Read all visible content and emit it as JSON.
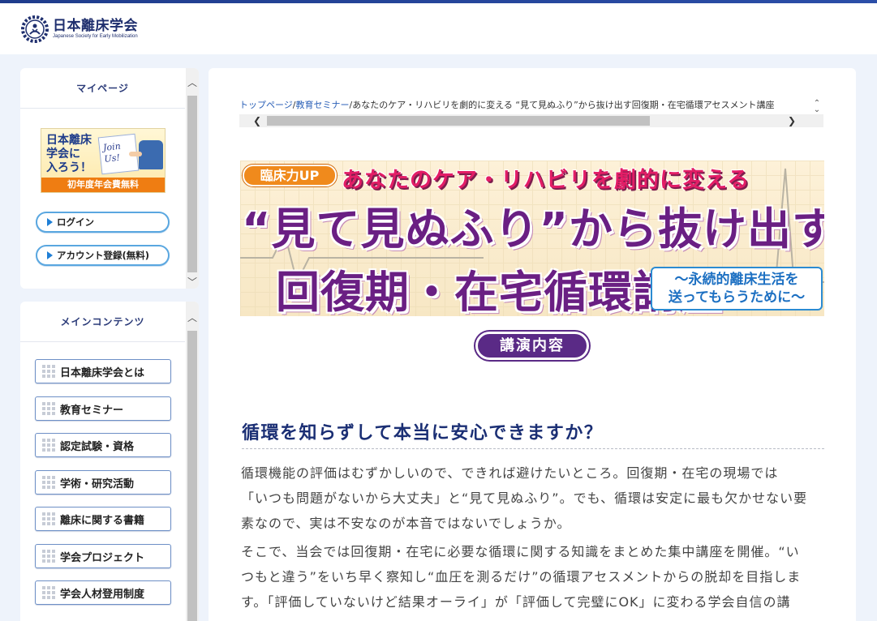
{
  "header": {
    "logo_ja": "日本離床学会",
    "logo_en": "Japanese Society for Early Mobilization"
  },
  "sidebar": {
    "mypage_title": "マイページ",
    "join_banner": {
      "line1": "日本離床",
      "line2": "学会に",
      "line3": "入ろう！",
      "card_text": "Join Us!",
      "fee_text": "初年度年会費無料"
    },
    "login_label": "ログイン",
    "register_label": "アカウント登録(無料)",
    "main_title": "メインコンテンツ",
    "nav_items": [
      {
        "label": "日本離床学会とは"
      },
      {
        "label": "教育セミナー"
      },
      {
        "label": "認定試験・資格"
      },
      {
        "label": "学術・研究活動"
      },
      {
        "label": "離床に関する書籍"
      },
      {
        "label": "学会プロジェクト"
      },
      {
        "label": "学会人材登用制度"
      }
    ]
  },
  "breadcrumb": {
    "home": "トップページ",
    "sep": "/",
    "seminar": "教育セミナー",
    "current": "あなたのケア・リハビリを劇的に変える “見て見ぬふり”から抜け出す回復期・在宅循環アセスメント講座"
  },
  "banner": {
    "tag": "臨床力UP",
    "line1": "あなたのケア・リハビリを劇的に変える",
    "line2": "“見て見ぬふり”から抜け出す",
    "line3": "回復期・在宅循環講座",
    "sub": "～永続的離床生活を\n送ってもらうために～"
  },
  "section_label": "講演内容",
  "heading": "循環を知らずして本当に安心できますか？",
  "paragraph1": [
    "循環機能の評価はむずかしいので、できれば避けたいところ。回復期・在宅の現場では",
    "「いつも問題がないから大丈夫」と“見て見ぬふり”。でも、循環は安定に最も欠かせない要",
    "素なので、実は不安なのが本音ではないでしょうか。"
  ],
  "paragraph2": [
    "そこで、当会では回復期・在宅に必要な循環に関する知識をまとめた集中講座を開催。“い",
    "つもと違う”をいち早く察知し“血圧を測るだけ”の循環アセスメントからの脱却を目指しま",
    "す。「評価していないけど結果オーライ」が「評価して完璧にOK」に変わる学会自信の講"
  ],
  "colors": {
    "brand_navy": "#1b2f74",
    "accent_purple": "#5a2a86",
    "link_blue": "#2d62b8",
    "pill_border": "#5aa7e0"
  }
}
